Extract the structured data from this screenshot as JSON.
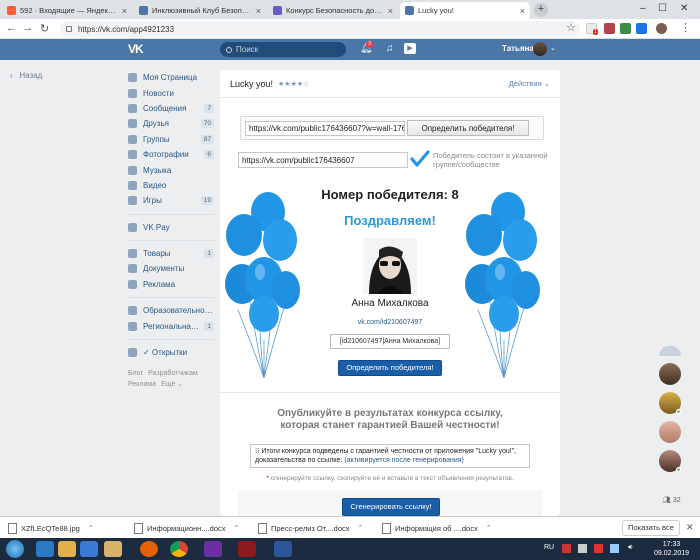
{
  "browser": {
    "tabs": [
      {
        "label": "592 · Входящие — Яндекс.Почта",
        "active": false,
        "color": "#ff5c33"
      },
      {
        "label": "Инклюзивный Клуб Безопасн",
        "active": false,
        "color": "#4a76a8"
      },
      {
        "label": "Конкурс Безопасность дошко",
        "active": false,
        "color": "#6a5acd"
      },
      {
        "label": "Lucky you!",
        "active": true,
        "color": "#4a76a8"
      }
    ],
    "url": "https://vk.com/app4921233",
    "extension_badge": "1"
  },
  "vk_header": {
    "logo": "VK",
    "search_placeholder": "Поиск",
    "notifications_count": "3",
    "user_name": "Татьяна"
  },
  "left_nav": {
    "back_label": "Назад",
    "groups": [
      [
        {
          "label": "Моя Страница",
          "count": "",
          "icon": "home-icon"
        },
        {
          "label": "Новости",
          "count": "",
          "icon": "news-icon"
        },
        {
          "label": "Сообщения",
          "count": "7",
          "icon": "messages-icon"
        },
        {
          "label": "Друзья",
          "count": "70",
          "icon": "friends-icon"
        },
        {
          "label": "Группы",
          "count": "87",
          "icon": "groups-icon"
        },
        {
          "label": "Фотографии",
          "count": "6",
          "icon": "photos-icon"
        },
        {
          "label": "Музыка",
          "count": "",
          "icon": "music-icon"
        },
        {
          "label": "Видео",
          "count": "",
          "icon": "video-icon"
        },
        {
          "label": "Игры",
          "count": "19",
          "icon": "games-icon"
        }
      ],
      [
        {
          "label": "VK Pay",
          "count": "",
          "icon": "vkpay-icon"
        }
      ],
      [
        {
          "label": "Товары",
          "count": "1",
          "icon": "goods-icon"
        },
        {
          "label": "Документы",
          "count": "",
          "icon": "documents-icon"
        },
        {
          "label": "Реклама",
          "count": "",
          "icon": "ads-icon"
        }
      ],
      [
        {
          "label": "Образовательное...",
          "count": "",
          "icon": "community-icon"
        },
        {
          "label": "Региональная ...",
          "count": "1",
          "icon": "community-icon"
        }
      ],
      [
        {
          "label": "✓ Открытки",
          "count": "",
          "icon": "apps-icon"
        }
      ]
    ],
    "footer": [
      "Блог",
      "Разработчикам",
      "Реклама",
      "Ещё ⌄"
    ]
  },
  "app": {
    "title": "Lucky you!",
    "rating": "★★★★☆",
    "actions_label": "Действия ⌄",
    "post_url": "https://vk.com/public176436607?w=wall-17643",
    "determine_button": "Определить победителя!",
    "group_url": "https://vk.com/public176436607",
    "check_text": "Победитель состоит в указанной группе/сообществе",
    "winner_number_label": "Номер победителя: 8",
    "congrats": "Поздравляем!",
    "winner_name": "Анна Михалкова",
    "winner_link": "vk.com/id210607497",
    "winner_tag": "[id210607497|Анна Михалкова]",
    "determine_button_2": "Определить победителя!",
    "publish_line1": "Опубликуйте в результатах конкурса ссылку,",
    "publish_line2": "которая станет гарантией Вашей честности!",
    "result_text": "⁝⁝ Итоги конкурса подведены с гарантией честности от приложения \"Lucky you!\", доказательства по ссылке:",
    "result_link": "(активируется после генерирования)",
    "hint_star": "*",
    "hint": "сгенерируйте ссылку, скопируйте её и вставьте в текст объявления результатов.",
    "generate_button": "Сгенерировать ссылку!"
  },
  "chat": {
    "count": "32"
  },
  "downloads": {
    "items": [
      "XZfLEcQTe88.jpg",
      "Информационн....docx",
      "Пресс-релиз От....docx",
      "Информация об ....docx"
    ],
    "show_all": "Показать все"
  },
  "taskbar": {
    "lang": "RU",
    "time": "17:33",
    "date": "09.02.2019"
  },
  "colors": {
    "vk_blue": "#4a76a8",
    "button_blue": "#1a5ea8",
    "congrats": "#2b9ad6",
    "balloon": "#2196e6"
  }
}
